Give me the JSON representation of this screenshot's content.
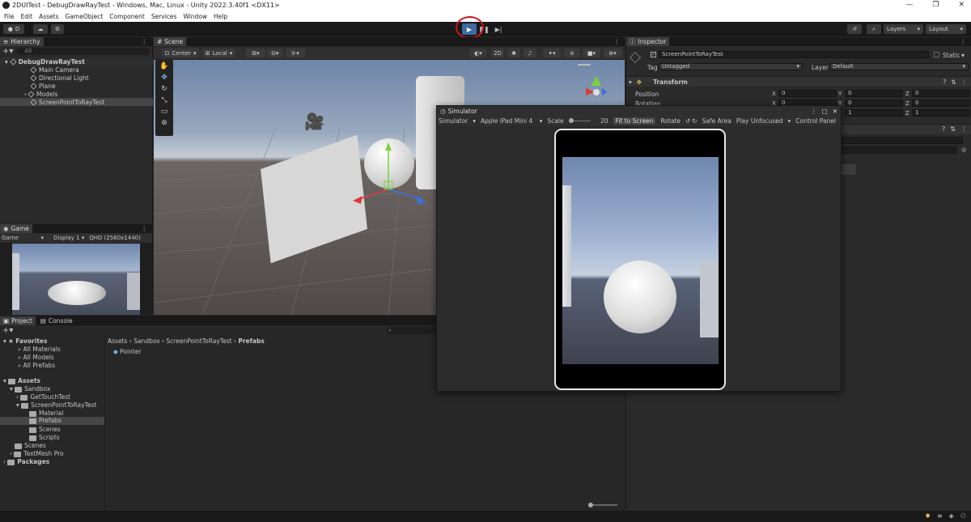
{
  "window": {
    "title": "2DUITest - DebugDrawRayTest - Windows, Mac, Linux - Unity 2022.3.40f1 <DX11>",
    "controls": [
      "—",
      "❐",
      "✕"
    ]
  },
  "menu": [
    "File",
    "Edit",
    "Assets",
    "GameObject",
    "Component",
    "Services",
    "Window",
    "Help"
  ],
  "toolbar": {
    "account": "D",
    "layers": "Layers",
    "layout": "Layout"
  },
  "hierarchy": {
    "title": "Hierarchy",
    "search": "All",
    "scene": "DebugDrawRayTest",
    "items": [
      "Main Camera",
      "Directional Light",
      "Plane",
      "Models",
      "ScreenPointToRayTest"
    ]
  },
  "scene": {
    "tab": "Scene",
    "pivot": "Center",
    "space": "Local",
    "mode2d": "2D"
  },
  "game": {
    "tab": "Game",
    "mode": "Game",
    "display": "Display 1",
    "resolution": "QHD (2560x1440)"
  },
  "project": {
    "tab_project": "Project",
    "tab_console": "Console",
    "breadcrumb": [
      "Assets",
      "Sandbox",
      "ScreenPointToRayTest",
      "Prefabs"
    ],
    "favorites": "Favorites",
    "fav_items": [
      "All Materials",
      "All Models",
      "All Prefabs"
    ],
    "assets": "Assets",
    "tree": [
      "Sandbox",
      "GetTouchTest",
      "ScreenPointToRayTest",
      "Material",
      "Prefabs",
      "Scenes",
      "Scripts",
      "Scenes",
      "TextMesh Pro"
    ],
    "packages": "Packages",
    "content_item": "Pointer"
  },
  "inspector": {
    "tab": "Inspector",
    "object_name": "ScreenPointToRayTest",
    "static": "Static",
    "tag_label": "Tag",
    "tag_value": "Untagged",
    "layer_label": "Layer",
    "layer_value": "Default",
    "component": "Transform",
    "position_label": "Position",
    "rotation_label": "Rotation",
    "position": {
      "x": "0",
      "y": "0",
      "z": "0"
    },
    "rotation": {
      "x": "0",
      "y": "0",
      "z": "0"
    },
    "scale": {
      "y": "1",
      "z": "1"
    }
  },
  "simulator": {
    "title": "Simulator",
    "mode": "Simulator",
    "device": "Apple iPad Mini 4",
    "scale_label": "Scale",
    "scale_value": "20",
    "fit": "Fit to Screen",
    "rotate": "Rotate",
    "safe_area": "Safe Area",
    "play_mode": "Play Unfocused",
    "control_panel": "Control Panel"
  }
}
